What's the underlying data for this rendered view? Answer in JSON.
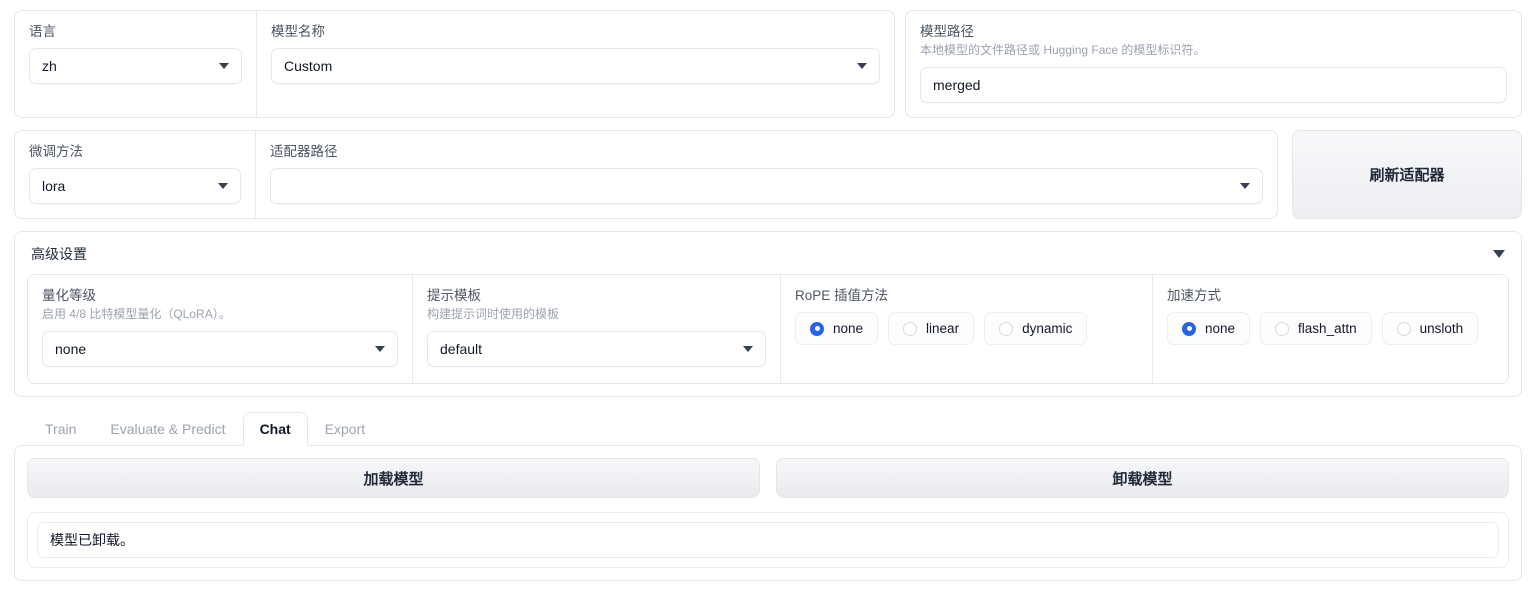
{
  "top_row": {
    "language": {
      "label": "语言",
      "value": "zh"
    },
    "model_name": {
      "label": "模型名称",
      "value": "Custom"
    },
    "model_path": {
      "label": "模型路径",
      "description": "本地模型的文件路径或 Hugging Face 的模型标识符。",
      "value": "merged"
    }
  },
  "second_row": {
    "finetune_method": {
      "label": "微调方法",
      "value": "lora"
    },
    "adapter_path": {
      "label": "适配器路径",
      "value": ""
    },
    "refresh_button": "刷新适配器"
  },
  "advanced": {
    "title": "高级设置",
    "quantization": {
      "label": "量化等级",
      "description": "启用 4/8 比特模型量化（QLoRA）。",
      "value": "none"
    },
    "template": {
      "label": "提示模板",
      "description": "构建提示词时使用的模板",
      "value": "default"
    },
    "rope": {
      "label": "RoPE 插值方法",
      "options": [
        "none",
        "linear",
        "dynamic"
      ],
      "selected": "none"
    },
    "booster": {
      "label": "加速方式",
      "options": [
        "none",
        "flash_attn",
        "unsloth"
      ],
      "selected": "none"
    }
  },
  "tabs": [
    {
      "label": "Train",
      "active": false
    },
    {
      "label": "Evaluate & Predict",
      "active": false
    },
    {
      "label": "Chat",
      "active": true
    },
    {
      "label": "Export",
      "active": false
    }
  ],
  "chat": {
    "load_button": "加载模型",
    "unload_button": "卸载模型",
    "status": "模型已卸载。"
  },
  "colors": {
    "accent": "#2563eb",
    "border": "#e5e7eb",
    "label": "#4b5563",
    "muted": "#9ca3af"
  }
}
